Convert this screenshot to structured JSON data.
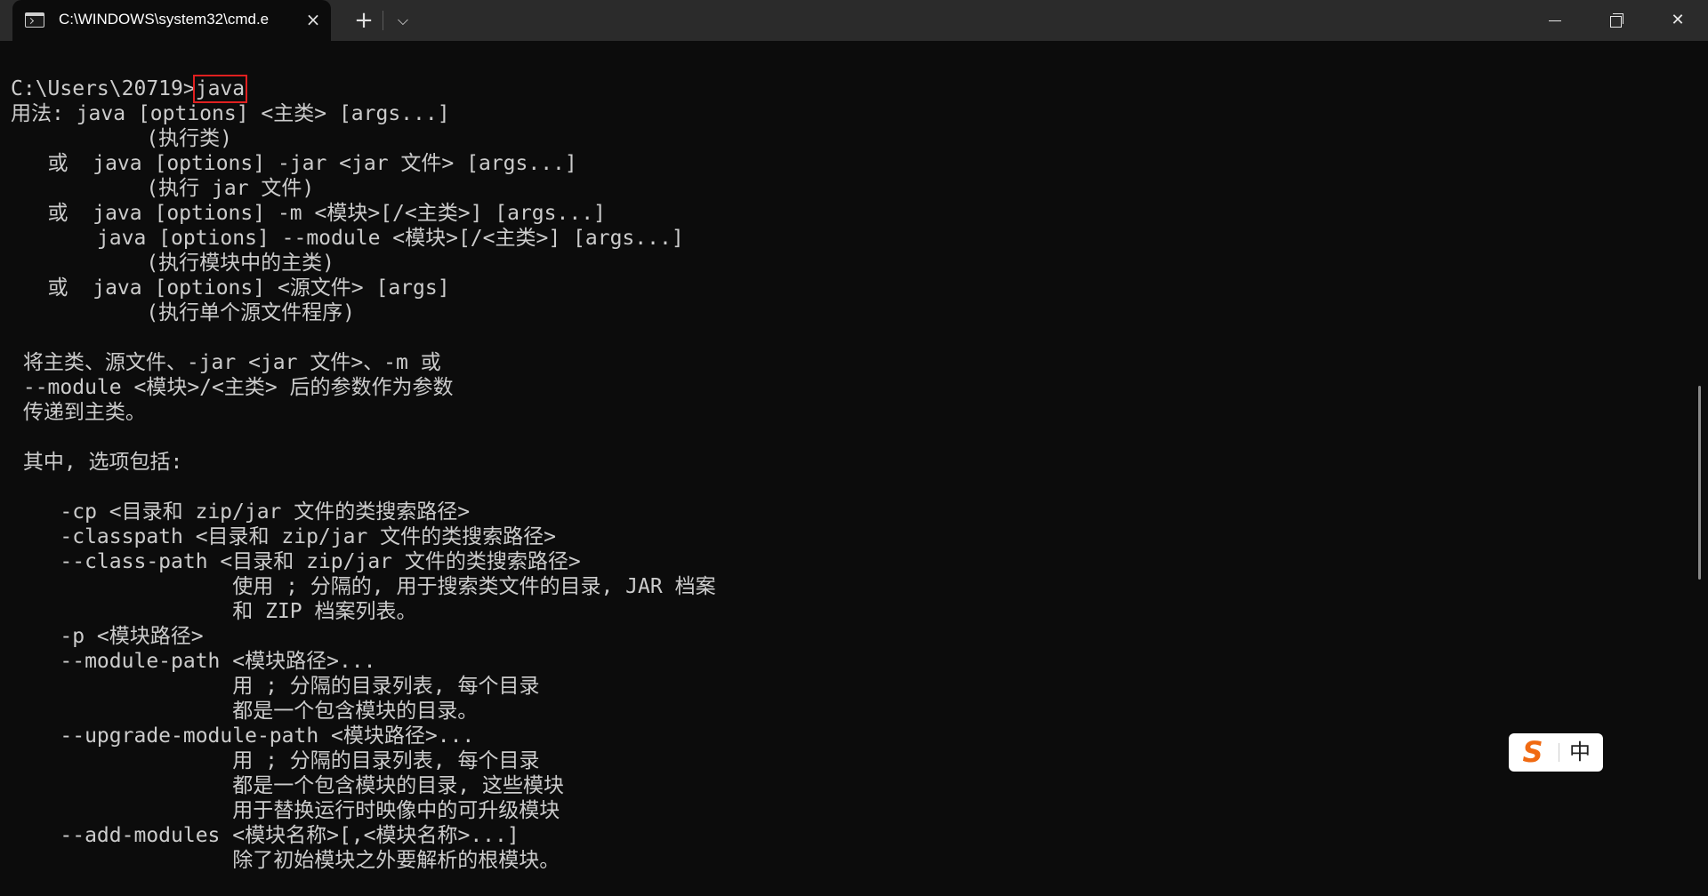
{
  "window": {
    "tab_title": "C:\\WINDOWS\\system32\\cmd.e",
    "tab_icon": "terminal-icon",
    "tab_close": "×",
    "new_tab": "+",
    "dropdown": "⌵",
    "close": "✕"
  },
  "console": {
    "prompt": "C:\\Users\\20719>",
    "command": "java",
    "lines": [
      "用法: java [options] <主类> [args...]",
      "           (执行类)",
      "   或  java [options] -jar <jar 文件> [args...]",
      "           (执行 jar 文件)",
      "   或  java [options] -m <模块>[/<主类>] [args...]",
      "       java [options] --module <模块>[/<主类>] [args...]",
      "           (执行模块中的主类)",
      "   或  java [options] <源文件> [args]",
      "           (执行单个源文件程序)",
      "",
      " 将主类、源文件、-jar <jar 文件>、-m 或",
      " --module <模块>/<主类> 后的参数作为参数",
      " 传递到主类。",
      "",
      " 其中, 选项包括:",
      "",
      "    -cp <目录和 zip/jar 文件的类搜索路径>",
      "    -classpath <目录和 zip/jar 文件的类搜索路径>",
      "    --class-path <目录和 zip/jar 文件的类搜索路径>",
      "                  使用 ; 分隔的, 用于搜索类文件的目录, JAR 档案",
      "                  和 ZIP 档案列表。",
      "    -p <模块路径>",
      "    --module-path <模块路径>...",
      "                  用 ; 分隔的目录列表, 每个目录",
      "                  都是一个包含模块的目录。",
      "    --upgrade-module-path <模块路径>...",
      "                  用 ; 分隔的目录列表, 每个目录",
      "                  都是一个包含模块的目录, 这些模块",
      "                  用于替换运行时映像中的可升级模块",
      "    --add-modules <模块名称>[,<模块名称>...]",
      "                  除了初始模块之外要解析的根模块。"
    ]
  },
  "ime": {
    "logo": "S",
    "mode": "中",
    "brand_color": "#f06a12"
  }
}
